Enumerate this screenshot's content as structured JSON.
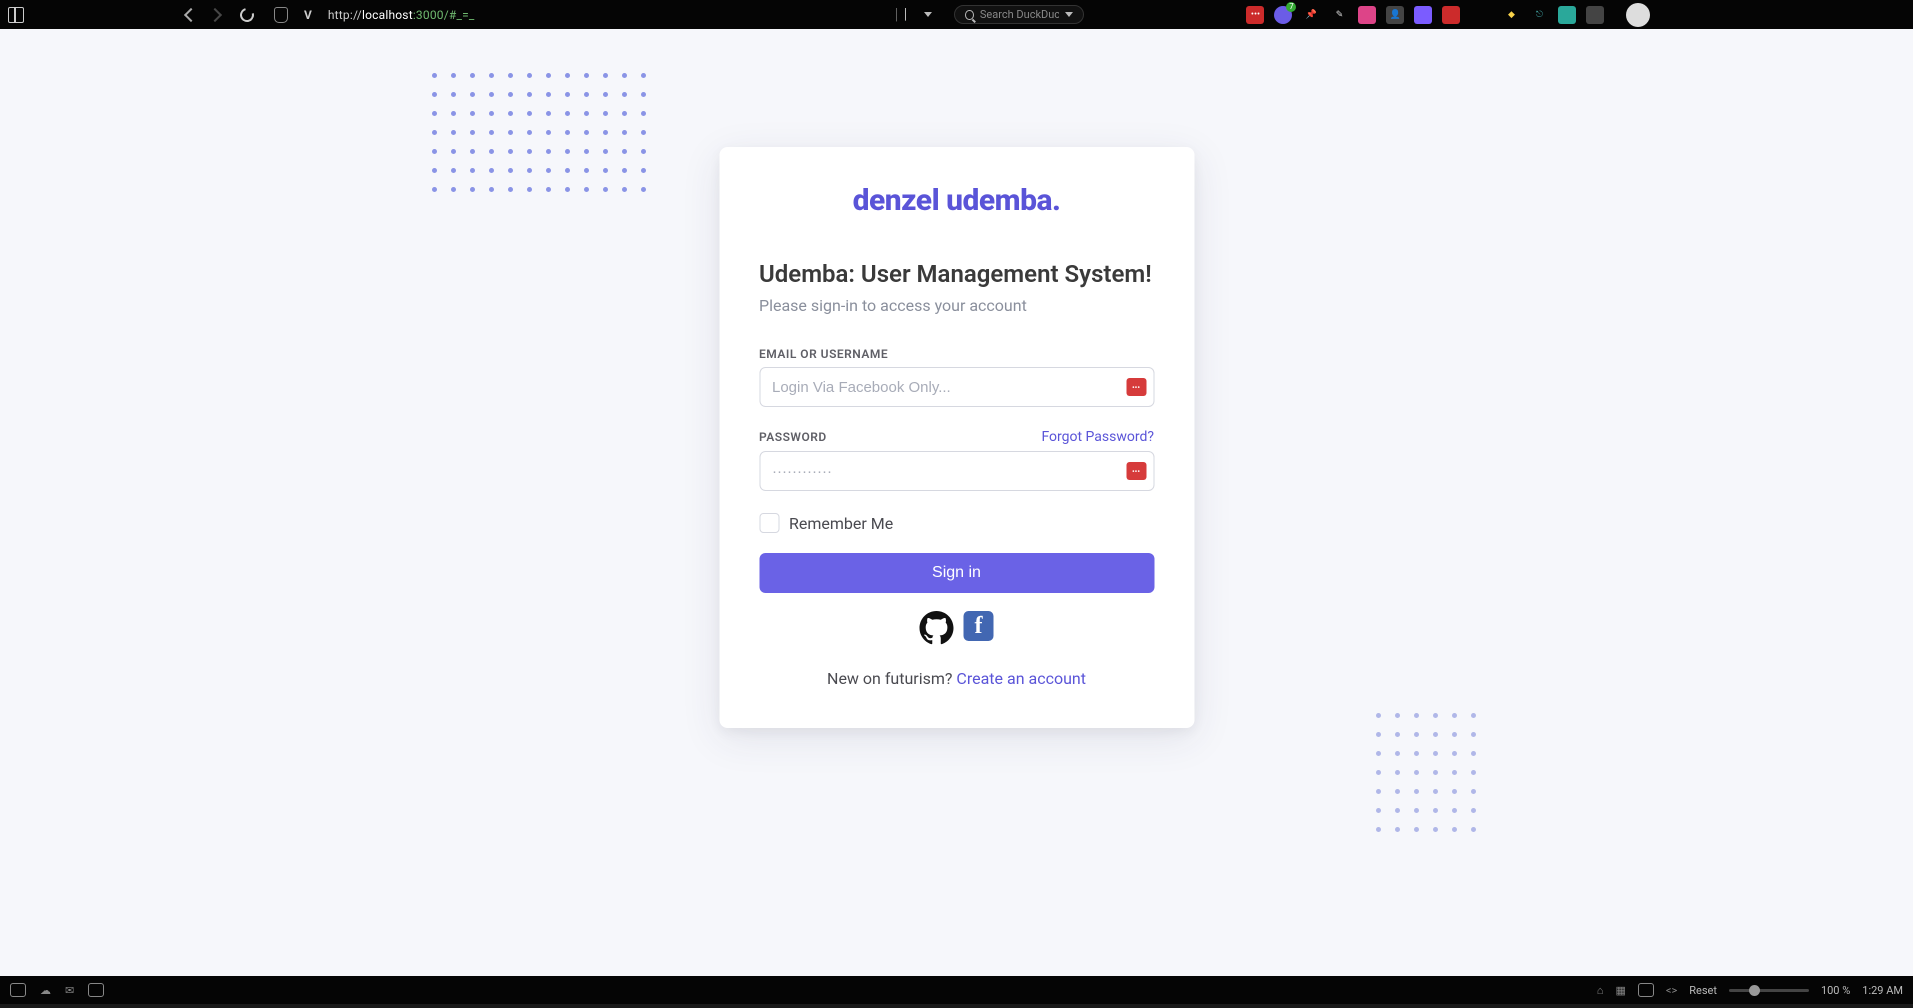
{
  "browser": {
    "url_prefix": "http://",
    "url_host": "localhost",
    "url_port": ":3000",
    "url_path": "/#_=_",
    "search_placeholder": "Search DuckDuckGo",
    "ext_badge": "7"
  },
  "page": {
    "logo": "denzel udemba.",
    "title": "Udemba: User Management System!",
    "subtitle": "Please sign-in to access your account",
    "email_label": "EMAIL OR USERNAME",
    "email_placeholder": "Login Via Facebook Only...",
    "password_label": "PASSWORD",
    "password_placeholder": "············",
    "forgot": "Forgot Password?",
    "remember": "Remember Me",
    "signin": "Sign in",
    "footer_prefix": "New on futurism? ",
    "footer_link": "Create an account"
  },
  "status": {
    "reset": "Reset",
    "zoom": "100 %",
    "time": "1:29 AM"
  }
}
